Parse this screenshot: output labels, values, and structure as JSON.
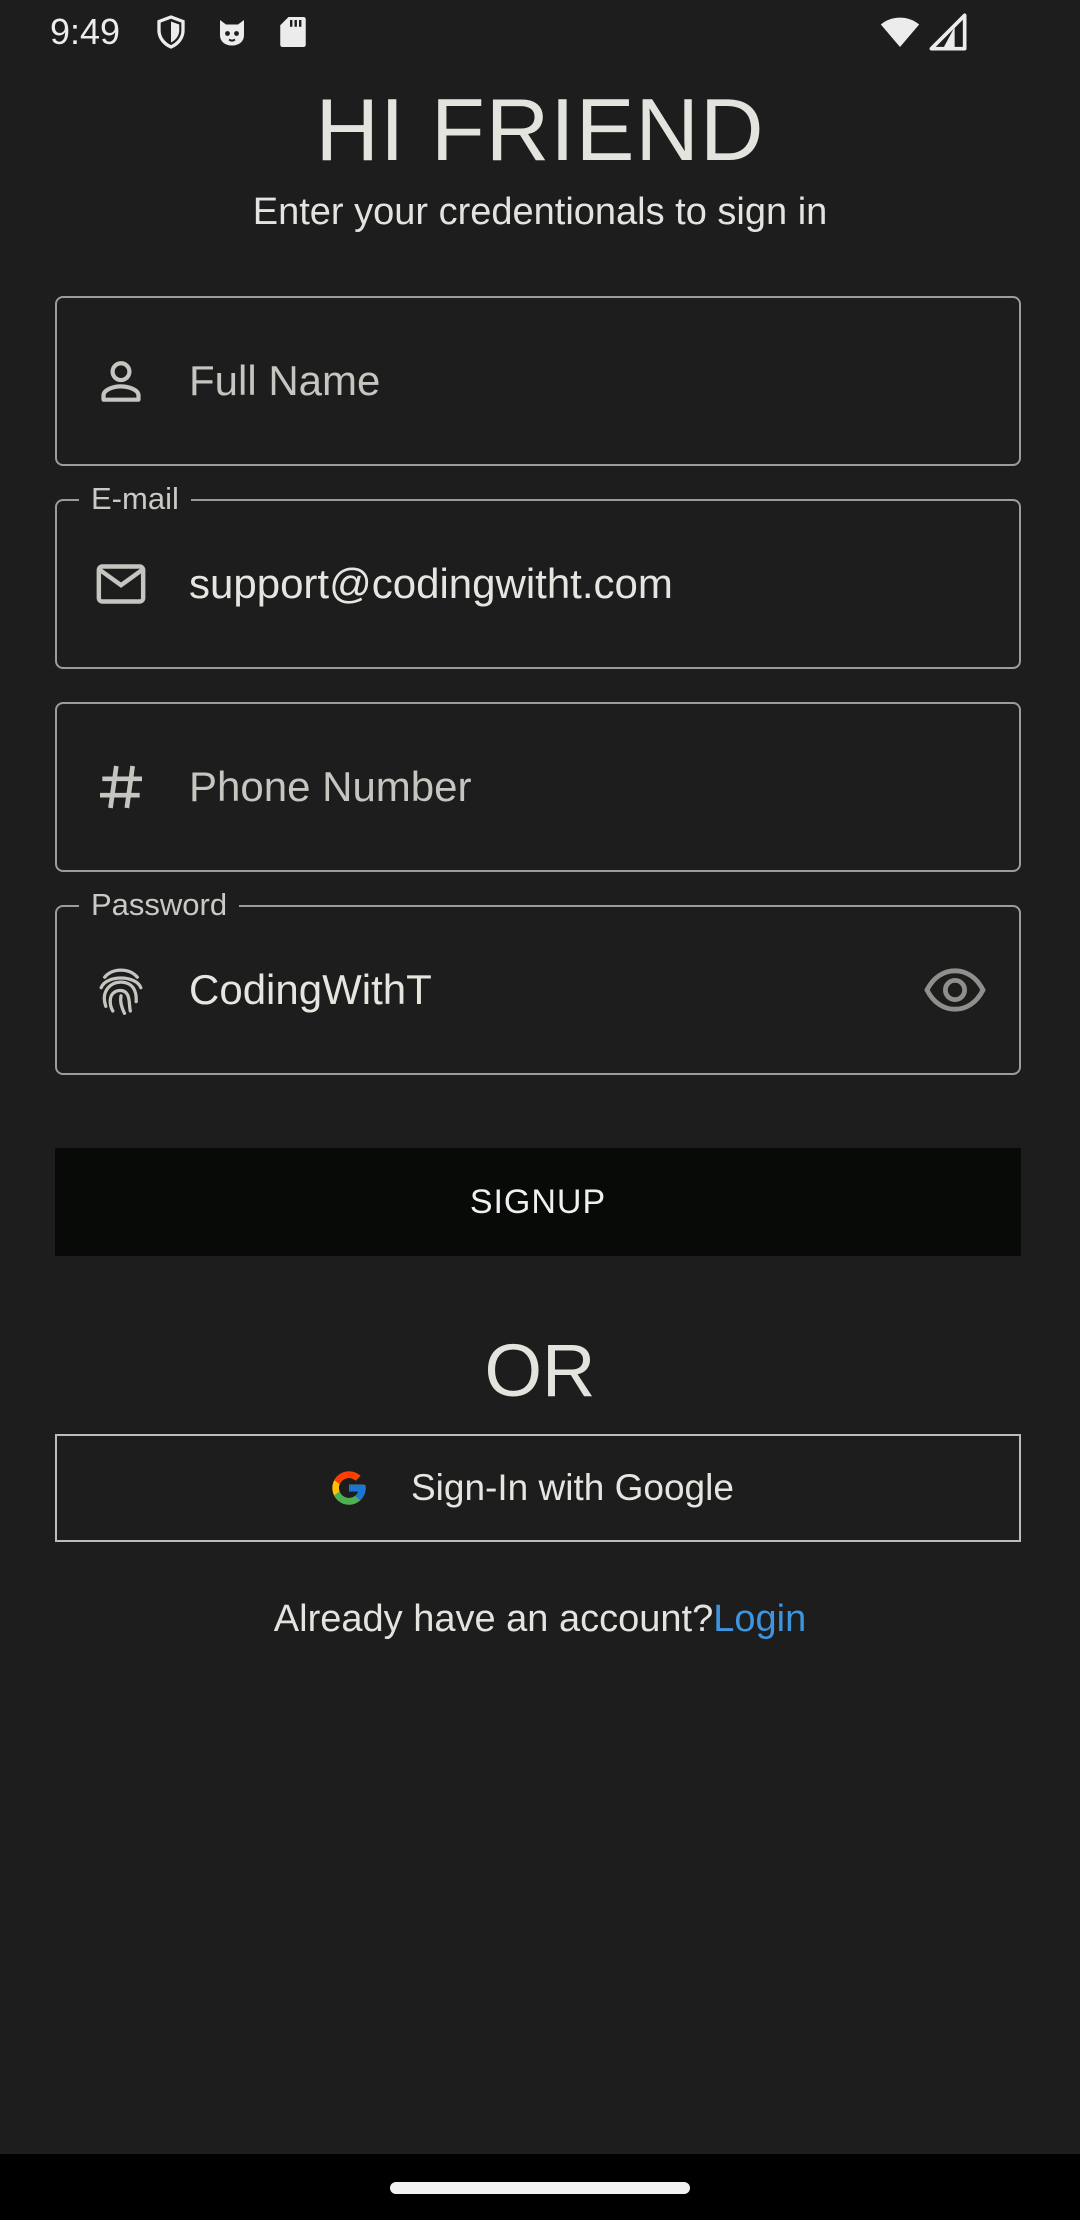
{
  "status_bar": {
    "time": "9:49",
    "left_icons": [
      "shield-icon",
      "cat-face-icon",
      "sd-card-icon"
    ],
    "right_icons": [
      "wifi-icon",
      "cellular-signal-icon"
    ]
  },
  "header": {
    "title": "HI FRIEND",
    "subtitle": "Enter your credentionals to sign in"
  },
  "form": {
    "full_name": {
      "placeholder": "Full Name",
      "value": "",
      "icon": "person-icon"
    },
    "email": {
      "label": "E-mail",
      "value": "support@codingwitht.com",
      "icon": "mail-icon"
    },
    "phone": {
      "placeholder": "Phone Number",
      "value": "",
      "icon": "hash-icon"
    },
    "password": {
      "label": "Password",
      "value": "CodingWithT",
      "icon": "fingerprint-icon",
      "toggle_icon": "eye-icon"
    }
  },
  "actions": {
    "signup_label": "SIGNUP",
    "or_text": "OR",
    "google_label": "Sign-In with Google",
    "login_prompt": "Already have an account?",
    "login_link": "Login"
  },
  "colors": {
    "background": "#1c1d1c",
    "signup_button": "#080a08",
    "link": "#3d95e0",
    "field_border": "#9b9d98"
  }
}
